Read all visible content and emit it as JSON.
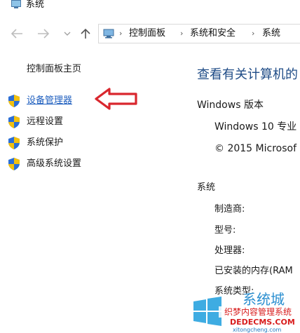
{
  "window": {
    "title": "系统"
  },
  "address": {
    "crumbs": [
      "控制面板",
      "系统和安全",
      "系统"
    ],
    "separator": "›"
  },
  "nav": {
    "home": "控制面板主页",
    "items": [
      {
        "label": "设备管理器"
      },
      {
        "label": "远程设置"
      },
      {
        "label": "系统保护"
      },
      {
        "label": "高级系统设置"
      }
    ]
  },
  "main": {
    "heading": "查看有关计算机的",
    "edition_heading": "Windows 版本",
    "edition_name": "Windows 10 专业",
    "copyright": "© 2015 Microsof",
    "system_heading": "系统",
    "rows": [
      "制造商:",
      "型号:",
      "处理器:",
      "已安装的内存(RAM",
      "系统类型:"
    ]
  },
  "watermark": {
    "line1": "系统城",
    "line2": "织梦内容管理系统",
    "line3": "DEDECMS.COM",
    "line4": "xitongcheng.com"
  },
  "colors": {
    "link": "#1f5fbf",
    "heading": "#1e4b86",
    "arrow": "#d9272e",
    "shield_blue": "#2c6fd6",
    "shield_yellow": "#f2c10f"
  }
}
